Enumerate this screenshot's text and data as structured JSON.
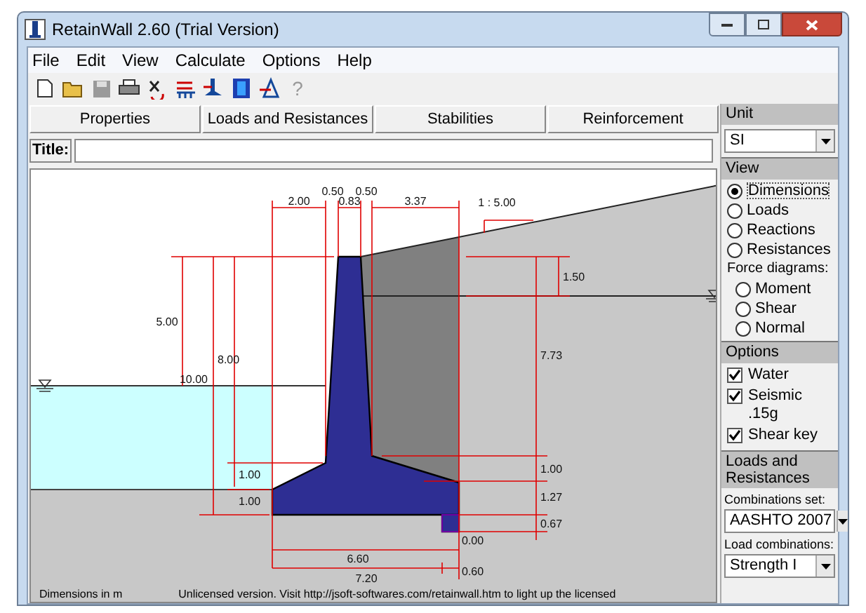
{
  "window": {
    "title": "RetainWall 2.60 (Trial Version)"
  },
  "menu": [
    "File",
    "Edit",
    "View",
    "Calculate",
    "Options",
    "Help"
  ],
  "toolbar": {
    "help": "?"
  },
  "tabs": [
    {
      "label": "Properties",
      "selected": false
    },
    {
      "label": "Loads and Resistances",
      "selected": false
    },
    {
      "label": "Stabilities",
      "selected": false
    },
    {
      "label": "Reinforcement",
      "selected": false
    }
  ],
  "title_field": {
    "label": "Title:"
  },
  "drawing": {
    "dimension_labels": [
      "2.00",
      "0.50",
      "0.83",
      "0.50",
      "3.37",
      "1 : 5.00",
      "1.50",
      "5.00",
      "8.00",
      "10.00",
      "7.73",
      "1.00",
      "1.00",
      "1.00",
      "1.27",
      "0.67",
      "0.00",
      "6.60",
      "7.20",
      "0.60"
    ]
  },
  "status_bar": {
    "units": "Dimensions in m",
    "notice": "Unlicensed version. Visit http://jsoft-softwares.com/retainwall.htm to light up the licensed"
  },
  "right_panel": {
    "unit": {
      "header": "Unit",
      "value": "SI"
    },
    "view": {
      "header": "View",
      "options": [
        {
          "label": "Dimensions",
          "selected": true
        },
        {
          "label": "Loads",
          "selected": false
        },
        {
          "label": "Reactions",
          "selected": false
        },
        {
          "label": "Resistances",
          "selected": false
        }
      ],
      "force_label": "Force diagrams:",
      "force_options": [
        {
          "label": "Moment",
          "selected": false
        },
        {
          "label": "Shear",
          "selected": false
        },
        {
          "label": "Normal",
          "selected": false
        }
      ]
    },
    "options": {
      "header": "Options",
      "items": [
        {
          "label": "Water",
          "checked": true
        },
        {
          "label": "Seismic",
          "checked": true,
          "note": ".15g"
        },
        {
          "label": "Shear key",
          "checked": true
        }
      ]
    },
    "loads": {
      "header": "Loads and Resistances",
      "combinations_set_label": "Combinations set:",
      "combinations_set": "AASHTO 2007",
      "load_combinations_label": "Load combinations:",
      "load_combinations": "Strength I"
    }
  }
}
